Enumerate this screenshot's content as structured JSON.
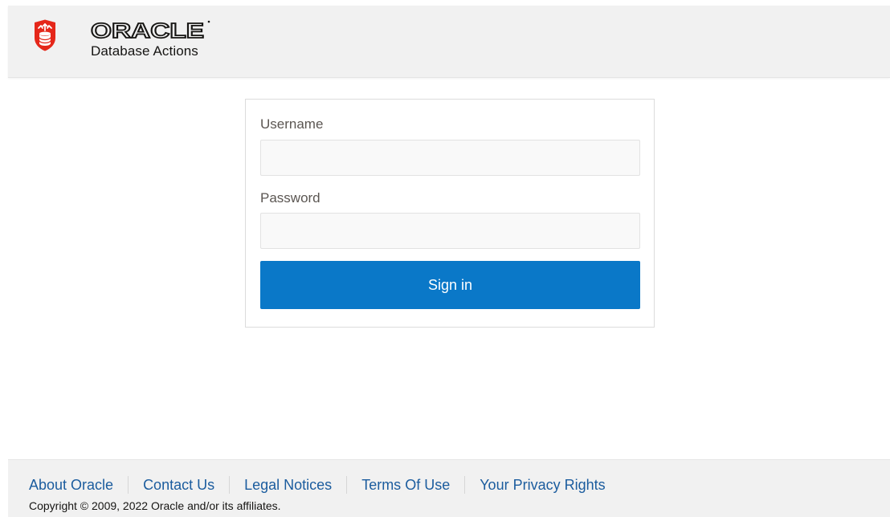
{
  "header": {
    "brand": "ORACLE",
    "product": "Database Actions",
    "logo_icon": "oracle-database-shield-icon",
    "brand_color": "#e5271a"
  },
  "login": {
    "username_label": "Username",
    "username_value": "",
    "password_label": "Password",
    "password_value": "",
    "signin_label": "Sign in",
    "button_color": "#0a78c8"
  },
  "footer": {
    "links": [
      {
        "label": "About Oracle"
      },
      {
        "label": "Contact Us"
      },
      {
        "label": "Legal Notices"
      },
      {
        "label": "Terms Of Use"
      },
      {
        "label": "Your Privacy Rights"
      }
    ],
    "copyright": "Copyright © 2009, 2022 Oracle and/or its affiliates.",
    "link_color": "#1b5c9e"
  }
}
